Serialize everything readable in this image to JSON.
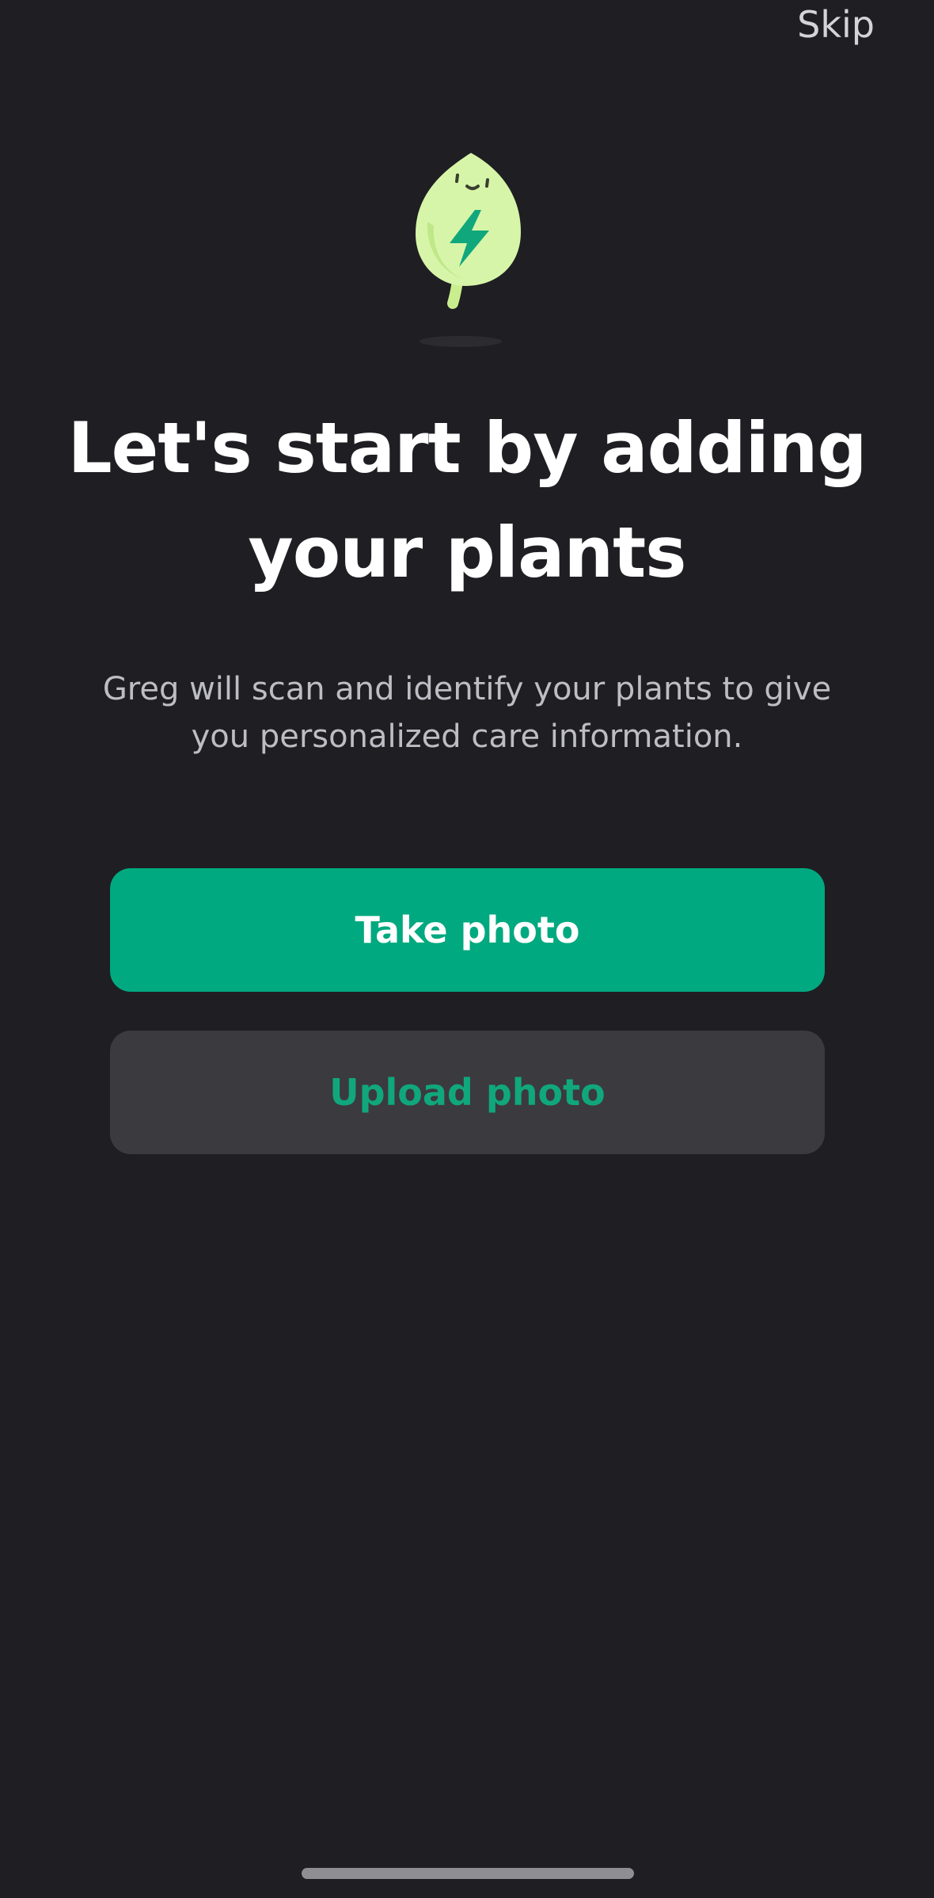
{
  "header": {
    "skip_label": "Skip"
  },
  "illustration": {
    "icon": "leaf-mascot-lightning-icon",
    "leaf_color": "#d7f5a8",
    "bolt_color": "#10a77c"
  },
  "content": {
    "headline": "Let's start by adding your plants",
    "subtitle": "Greg will scan and identify your plants to give you personalized care information."
  },
  "actions": {
    "take_photo_label": "Take photo",
    "upload_photo_label": "Upload photo"
  },
  "colors": {
    "background": "#1f1e23",
    "accent": "#00a97f",
    "secondary_button": "#3b3a3f"
  }
}
